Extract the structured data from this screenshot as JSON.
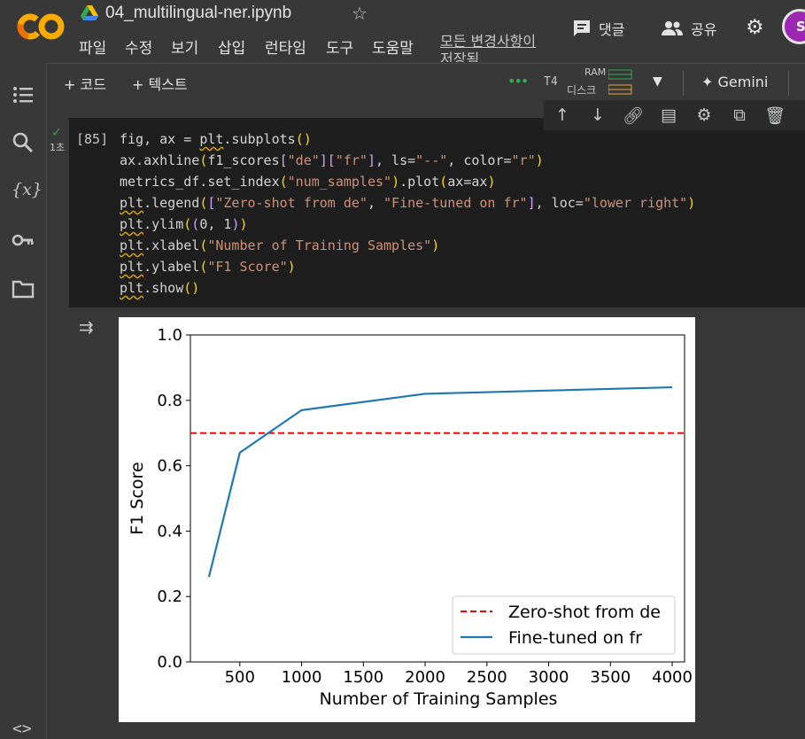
{
  "header": {
    "notebook_title": "04_multilingual-ner.ipynb",
    "menu": [
      "파일",
      "수정",
      "보기",
      "삽입",
      "런타임",
      "도구",
      "도움말"
    ],
    "save_status": "모든 변경사항이 저장됨",
    "comment_label": "댓글",
    "share_label": "공유",
    "avatar_letter": "S"
  },
  "toolbar": {
    "add_code": "+ 코드",
    "add_text": "+ 텍스트",
    "runtime_type": "T4",
    "ram_label": "RAM",
    "disk_label": "디스크",
    "gemini_label": "Gemini"
  },
  "cell": {
    "exec_count": "[85]",
    "run_time": "1초",
    "code": [
      "fig, ax = plt.subplots()",
      "ax.axhline(f1_scores[\"de\"][\"fr\"], ls=\"--\", color=\"r\")",
      "metrics_df.set_index(\"num_samples\").plot(ax=ax)",
      "plt.legend([\"Zero-shot from de\", \"Fine-tuned on fr\"], loc=\"lower right\")",
      "plt.ylim((0, 1))",
      "plt.xlabel(\"Number of Training Samples\")",
      "plt.ylabel(\"F1 Score\")",
      "plt.show()"
    ]
  },
  "colors": {
    "line": "#1f77b4",
    "hline": "#ff0000",
    "accent_green": "#34a853"
  },
  "chart_data": {
    "type": "line",
    "title": "",
    "xlabel": "Number of Training Samples",
    "ylabel": "F1 Score",
    "xlim": [
      100,
      4100
    ],
    "ylim": [
      0,
      1
    ],
    "x_ticks": [
      "500",
      "1000",
      "1500",
      "2000",
      "2500",
      "3000",
      "3500",
      "4000"
    ],
    "y_ticks": [
      "0.0",
      "0.2",
      "0.4",
      "0.6",
      "0.8",
      "1.0"
    ],
    "grid": false,
    "legend_position": "lower-right",
    "hline": {
      "name": "Zero-shot from de",
      "y": 0.7,
      "style": "dashed",
      "color": "#ff0000"
    },
    "series": [
      {
        "name": "Fine-tuned on fr",
        "color": "#1f77b4",
        "x": [
          250,
          500,
          1000,
          2000,
          4000
        ],
        "y": [
          0.26,
          0.64,
          0.77,
          0.82,
          0.84
        ]
      }
    ]
  }
}
